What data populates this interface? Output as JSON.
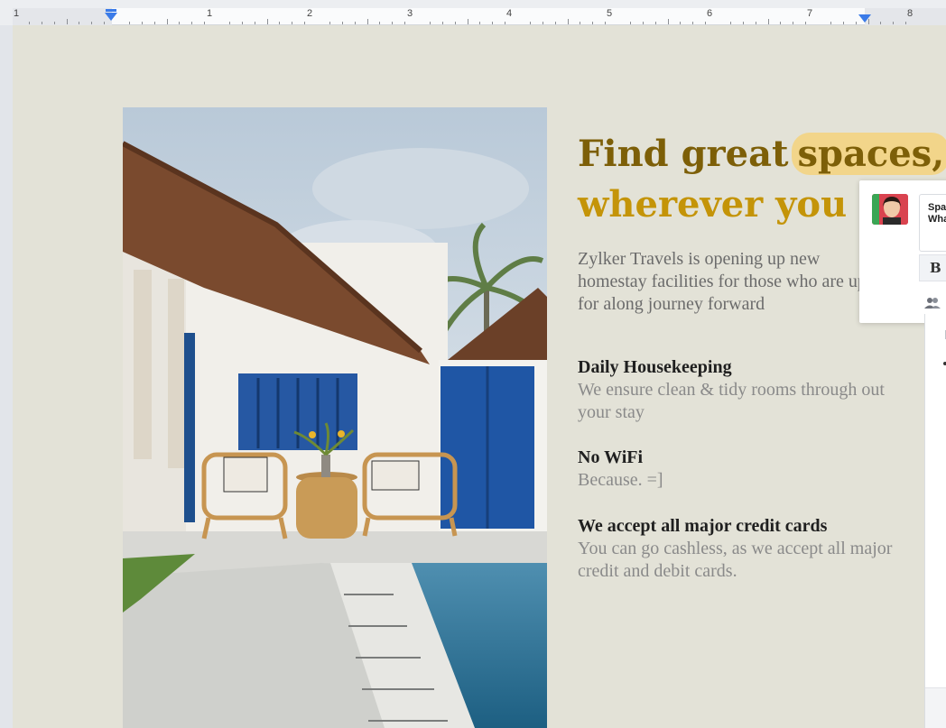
{
  "ruler": {
    "numbers": [
      "1",
      "1",
      "2",
      "3",
      "4",
      "5",
      "6",
      "7",
      "8"
    ]
  },
  "document": {
    "headline": {
      "line1_prefix": "Find great",
      "line1_highlight": "spaces,",
      "line2": "wherever you g"
    },
    "intro": "Zylker Travels is opening up new homestay facilities for those who are up for along journey forward",
    "features": [
      {
        "title": "Daily Housekeeping",
        "description": "We ensure clean & tidy rooms through out your stay"
      },
      {
        "title": "No WiFi",
        "description": "Because. =]"
      },
      {
        "title": "We accept all major credit cards",
        "description": "You can go cashless, as we accept all major credit and debit cards."
      }
    ]
  },
  "comment": {
    "line1": "Spa",
    "line2": "Wha",
    "bold_label": "B"
  },
  "colors": {
    "headline_dark": "#7d5f08",
    "headline_gold": "#c49408",
    "highlight": "#f2d58a",
    "page_bg": "#e3e2d7",
    "ruler_marker": "#3b7be8"
  }
}
